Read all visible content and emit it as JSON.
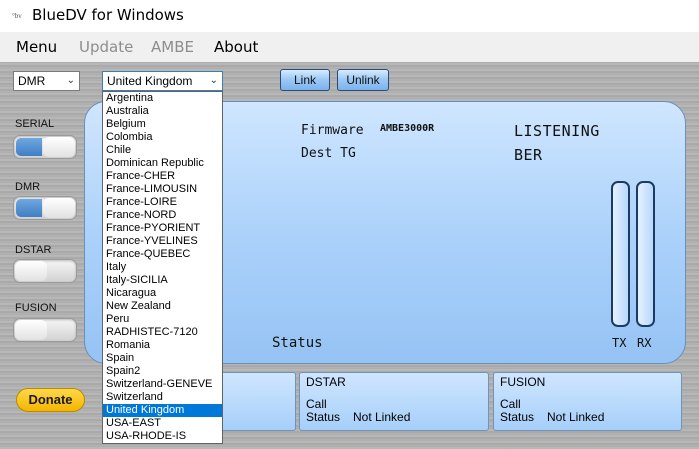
{
  "window": {
    "title": "BlueDV for Windows",
    "icon_text": "°bv"
  },
  "menubar": [
    {
      "label": "Menu",
      "enabled": true
    },
    {
      "label": "Update",
      "enabled": false
    },
    {
      "label": "AMBE",
      "enabled": false
    },
    {
      "label": "About",
      "enabled": true
    }
  ],
  "toolbar": {
    "mode_select": "DMR",
    "country_select": "United Kingdom",
    "link_label": "Link",
    "unlink_label": "Unlink"
  },
  "modes": {
    "serial": {
      "label": "SERIAL",
      "on": true
    },
    "dmr": {
      "label": "DMR",
      "on": true
    },
    "dstar": {
      "label": "DSTAR",
      "on": false
    },
    "fusion": {
      "label": "FUSION",
      "on": false
    }
  },
  "display": {
    "firmware_label": "Firmware",
    "firmware_value": "AMBE3000R",
    "dest_label": "Dest TG",
    "state": "LISTENING",
    "ber_label": "BER",
    "status_label": "Status",
    "tx_label": "TX",
    "rx_label": "RX",
    "tx_level": 0,
    "rx_level": 0
  },
  "panels": {
    "dstar": {
      "title": "DSTAR",
      "call_label": "Call",
      "status_label": "Status",
      "status_value": "Not Linked"
    },
    "fusion": {
      "title": "FUSION",
      "call_label": "Call",
      "status_label": "Status",
      "status_value": "Not Linked"
    }
  },
  "donate_label": "Donate",
  "dropdown": {
    "selected": "United Kingdom",
    "items": [
      "Argentina",
      "Australia",
      "Belgium",
      "Colombia",
      "Chile",
      "Dominican Republic",
      "France-CHER",
      "France-LIMOUSIN",
      "France-LOIRE",
      "France-NORD",
      "France-PYORIENT",
      "France-YVELINES",
      "France-QUEBEC",
      "Italy",
      "Italy-SICILIA",
      "Nicaragua",
      "New Zealand",
      "Peru",
      "RADHISTEC-7120",
      "Romania",
      "Spain",
      "Spain2",
      "Switzerland-GENEVE",
      "Switzerland",
      "United Kingdom",
      "USA-EAST",
      "USA-RHODE-IS"
    ]
  },
  "colors": {
    "display_bg": "#a9d0fa",
    "selection": "#0078d7",
    "donate": "#f5b500"
  }
}
